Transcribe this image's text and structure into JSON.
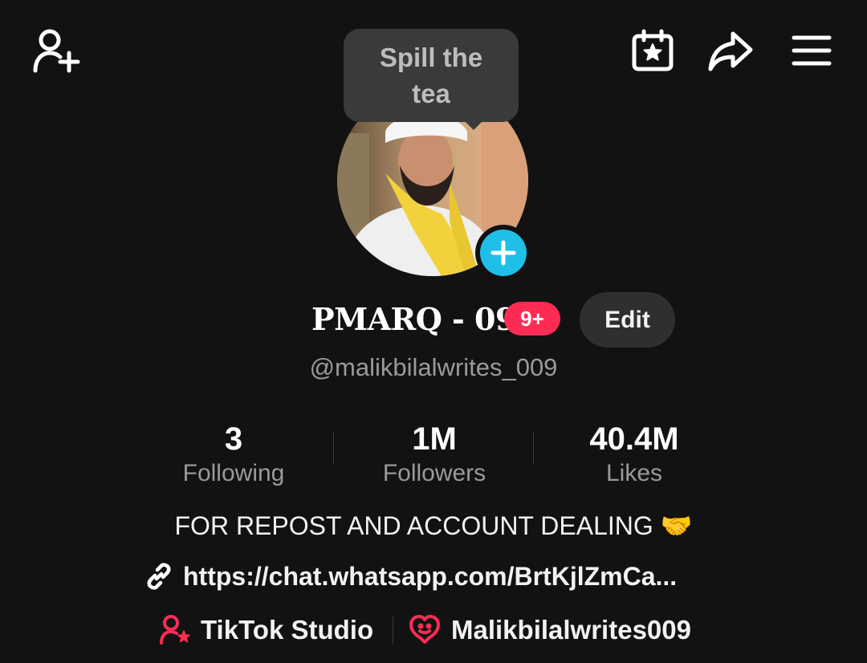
{
  "tooltip": {
    "text": "Spill the tea"
  },
  "profile": {
    "display_name": "PMARQ - 09",
    "badge": "9+",
    "edit_label": "Edit",
    "username": "@malikbilalwrites_009"
  },
  "stats": [
    {
      "value": "3",
      "label": "Following"
    },
    {
      "value": "1M",
      "label": "Followers"
    },
    {
      "value": "40.4M",
      "label": "Likes"
    }
  ],
  "bio": {
    "text": "FOR REPOST AND ACCOUNT DEALING",
    "emoji": "🤝"
  },
  "link": {
    "text": "https://chat.whatsapp.com/BrtKjlZmCa..."
  },
  "bottom": {
    "studio_label": "TikTok Studio",
    "account_label": "Malikbilalwrites009"
  },
  "colors": {
    "background": "#121212",
    "accent_red": "#fe2c55",
    "accent_cyan": "#20bfe8",
    "muted_text": "#9a9a9a"
  },
  "icons": {
    "top_left": "add-friend-icon",
    "top_right": [
      "calendar-star-icon",
      "share-icon",
      "menu-icon"
    ],
    "link": "link-icon",
    "studio": "creator-icon",
    "account": "heart-chat-icon"
  }
}
